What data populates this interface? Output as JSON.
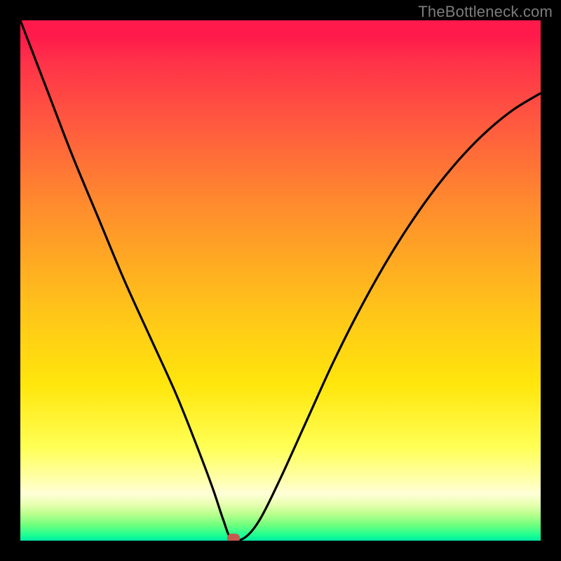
{
  "watermark": "TheBottleneck.com",
  "colors": {
    "frame_bg": "#000000",
    "dot_fill": "#c65a4f",
    "curve_stroke": "#000000"
  },
  "chart_data": {
    "type": "line",
    "title": "",
    "xlabel": "",
    "ylabel": "",
    "xlim": [
      0,
      100
    ],
    "ylim": [
      0,
      100
    ],
    "annotations": [
      {
        "name": "minimum-marker",
        "x": 41,
        "y": 0
      }
    ],
    "series": [
      {
        "name": "bottleneck-curve",
        "x": [
          0,
          5,
          10,
          15,
          20,
          25,
          30,
          34,
          37,
          39,
          40.5,
          43,
          46,
          50,
          55,
          60,
          65,
          70,
          75,
          80,
          85,
          90,
          95,
          100
        ],
        "y": [
          100,
          87,
          74,
          62,
          50,
          39,
          28,
          18,
          10,
          4,
          0.5,
          0.5,
          4,
          12,
          23,
          34,
          44,
          53,
          61,
          68,
          74,
          79,
          83,
          86
        ]
      }
    ]
  }
}
